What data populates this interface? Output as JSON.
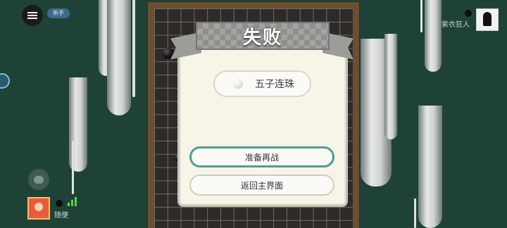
{
  "top_bar": {
    "menu_icon": "hamburger-menu-icon",
    "badge_label": "新手"
  },
  "players": {
    "left": {
      "name": "随便",
      "stone": "black"
    },
    "right": {
      "name": "紫衣狂人",
      "stone": "black"
    }
  },
  "dialog": {
    "title": "失败",
    "result_label": "五子连珠",
    "result_stone": "white",
    "primary_button": "准备再战",
    "secondary_button": "返回主界面"
  },
  "colors": {
    "background": "#1e4336",
    "primary_border": "#4e9e94",
    "dialog_bg": "#f7f4e8",
    "signal": "#59d24e"
  }
}
